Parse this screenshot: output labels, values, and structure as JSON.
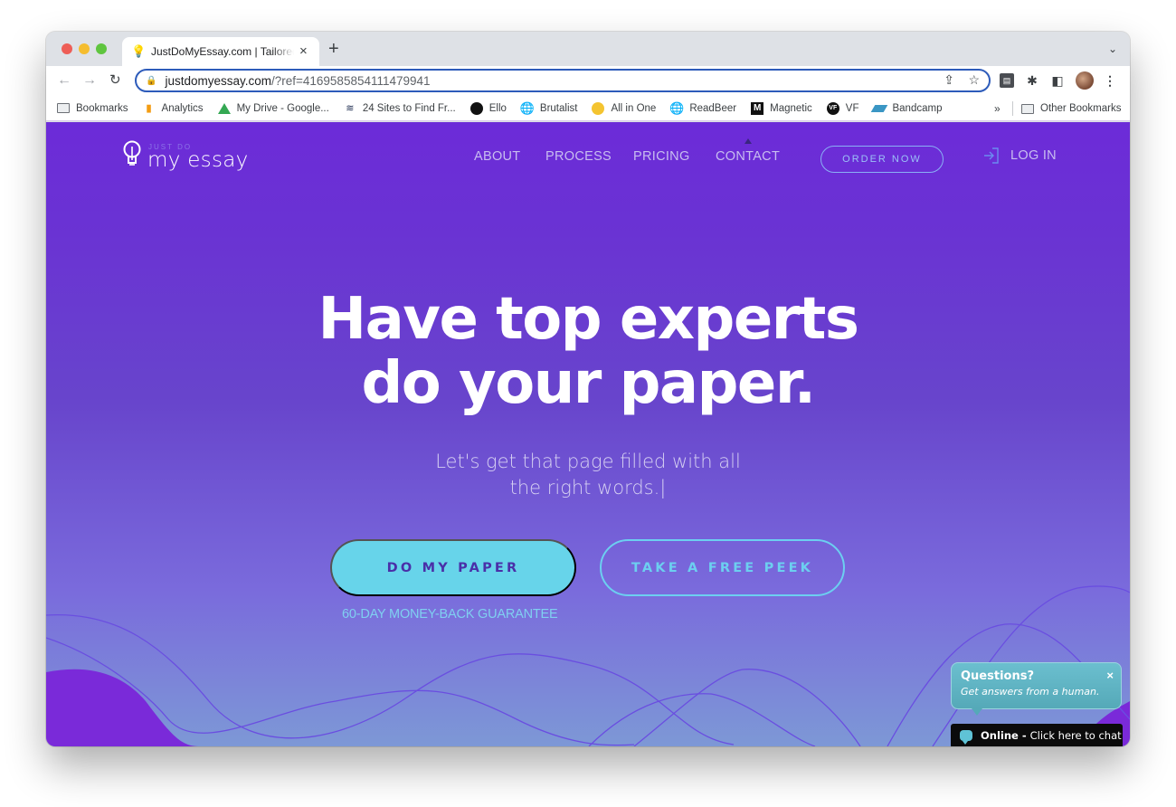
{
  "browser": {
    "tab": {
      "title": "JustDoMyEssay.com | Tailored",
      "favicon": "lightbulb-icon"
    },
    "new_tab_label": "+",
    "url": {
      "domain": "justdomyessay.com",
      "path": "/?ref=4169585854111479941"
    },
    "bookmarks": [
      {
        "label": "Bookmarks",
        "icon": "folder-icon"
      },
      {
        "label": "Analytics",
        "icon": "analytics-icon"
      },
      {
        "label": "My Drive - Google...",
        "icon": "google-drive-icon"
      },
      {
        "label": "24 Sites to Find Fr...",
        "icon": "stack-icon"
      },
      {
        "label": "Ello",
        "icon": "ello-icon"
      },
      {
        "label": "Brutalist",
        "icon": "globe-icon"
      },
      {
        "label": "All in One",
        "icon": "all-in-one-icon"
      },
      {
        "label": "ReadBeer",
        "icon": "globe-icon"
      },
      {
        "label": "Magnetic",
        "icon": "magnetic-icon"
      },
      {
        "label": "VF",
        "icon": "vf-icon"
      },
      {
        "label": "Bandcamp",
        "icon": "bandcamp-icon"
      }
    ],
    "bookmarks_overflow": "»",
    "other_bookmarks": "Other Bookmarks"
  },
  "site": {
    "logo": {
      "small": "JUST DO",
      "main": "my essay"
    },
    "nav": [
      "ABOUT",
      "PROCESS",
      "PRICING",
      "CONTACT"
    ],
    "order_button": "ORDER NOW",
    "login": "LOG IN",
    "headline": [
      "Have top experts",
      "do your paper."
    ],
    "subhead": [
      "Let's get that page filled with all",
      "the right words.|"
    ],
    "primary_cta": "DO MY PAPER",
    "secondary_cta": "TAKE A FREE PEEK",
    "guarantee": "60-DAY MONEY-BACK GUARANTEE",
    "colors": {
      "hero_top": "#6c2bd8",
      "hero_bottom": "#7d98d6",
      "cta_primary": "#67d4ea",
      "cta_outline": "#6ccff0"
    }
  },
  "chat": {
    "title": "Questions?",
    "subtitle": "Get answers from a human.",
    "close": "×",
    "status": "Online -",
    "action": "Click here to chat"
  }
}
